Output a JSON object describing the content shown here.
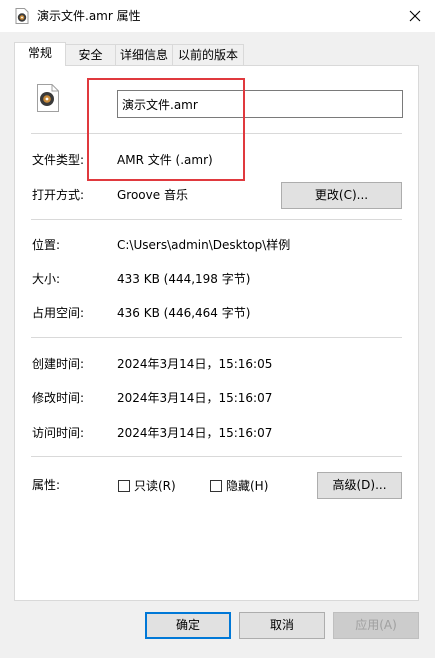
{
  "window": {
    "title": "演示文件.amr 属性",
    "close_icon": "close-icon",
    "file_icon": "audio-file-icon"
  },
  "tabs": [
    {
      "label": "常规",
      "active": true
    },
    {
      "label": "安全",
      "active": false
    },
    {
      "label": "详细信息",
      "active": false
    },
    {
      "label": "以前的版本",
      "active": false
    }
  ],
  "general": {
    "filename": "演示文件.amr",
    "file_type_label": "文件类型:",
    "file_type_value": "AMR 文件 (.amr)",
    "open_with_label": "打开方式:",
    "open_with_value": "Groove 音乐",
    "change_button": "更改(C)...",
    "location_label": "位置:",
    "location_value": "C:\\Users\\admin\\Desktop\\样例",
    "size_label": "大小:",
    "size_value": "433 KB (444,198 字节)",
    "size_on_disk_label": "占用空间:",
    "size_on_disk_value": "436 KB (446,464 字节)",
    "created_label": "创建时间:",
    "created_value": "2024年3月14日，15:16:05",
    "modified_label": "修改时间:",
    "modified_value": "2024年3月14日，15:16:07",
    "accessed_label": "访问时间:",
    "accessed_value": "2024年3月14日，15:16:07",
    "attributes_label": "属性:",
    "readonly_label": "只读(R)",
    "readonly_checked": false,
    "hidden_label": "隐藏(H)",
    "hidden_checked": false,
    "advanced_button": "高级(D)..."
  },
  "footer": {
    "ok_button": "确定",
    "cancel_button": "取消",
    "apply_button": "应用(A)"
  },
  "colors": {
    "accent": "#0078d7",
    "highlight_box": "#e0393e"
  }
}
